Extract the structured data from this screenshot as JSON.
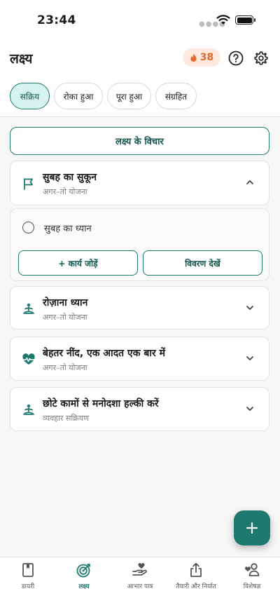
{
  "status_bar": {
    "time": "23:44"
  },
  "header": {
    "title": "लक्ष्य",
    "streak_count": "38"
  },
  "tabs": [
    {
      "label": "सक्रिय",
      "active": true
    },
    {
      "label": "रोका हुआ",
      "active": false
    },
    {
      "label": "पूरा हुआ",
      "active": false
    },
    {
      "label": "संग्रहित",
      "active": false
    }
  ],
  "ideas_button": "लक्ष्य के विचार",
  "goals": [
    {
      "title": "सुबह का सुकून",
      "subtitle": "अगर–तो योजना",
      "icon": "flag-icon",
      "expanded": true
    },
    {
      "title": "रोज़ाना ध्यान",
      "subtitle": "अगर–तो योजना",
      "icon": "meditation-icon",
      "expanded": false
    },
    {
      "title": "बेहतर नींद, एक आदत एक बार में",
      "subtitle": "अगर–तो योजना",
      "icon": "heartbeat-icon",
      "expanded": false
    },
    {
      "title": "छोटे कामों से मनोदशा हल्की करें",
      "subtitle": "व्यवहार सक्रियण",
      "icon": "meditation-icon",
      "expanded": false
    }
  ],
  "expanded_section": {
    "task": "सुबह का ध्यान",
    "add_task_button": "+ कार्य जोड़ें",
    "view_details_button": "विवरण देखें"
  },
  "bottom_nav": [
    {
      "label": "डायरी",
      "icon": "diary-icon",
      "active": false
    },
    {
      "label": "लक्ष्य",
      "icon": "target-icon",
      "active": true
    },
    {
      "label": "आभार पात्र",
      "icon": "gratitude-icon",
      "active": false
    },
    {
      "label": "तैयारी और निर्यात",
      "icon": "share-icon",
      "active": false
    },
    {
      "label": "विशेषज्ञ",
      "icon": "expert-icon",
      "active": false
    }
  ],
  "colors": {
    "accent": "#1e7a6f",
    "accent_light": "#d6f3ee",
    "streak": "#e06a2b",
    "streak_bg": "#fde9dd"
  }
}
